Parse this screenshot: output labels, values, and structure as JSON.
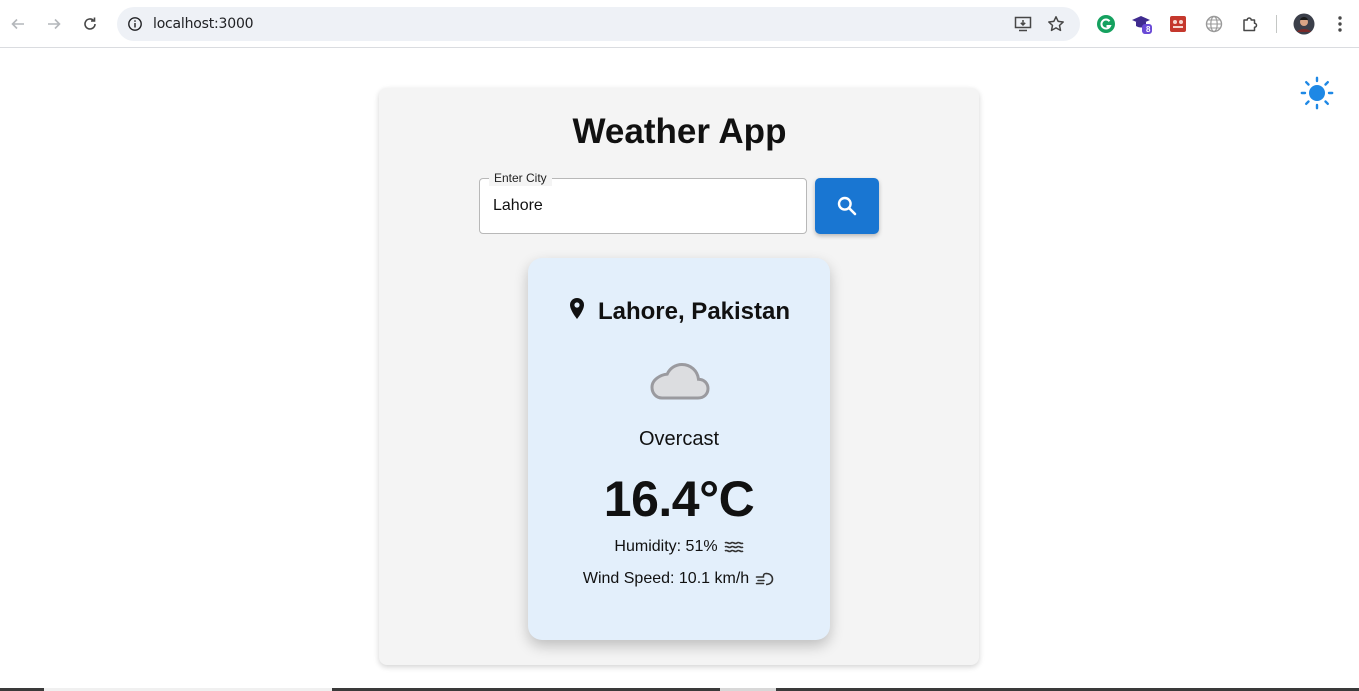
{
  "browser": {
    "url": "localhost:3000",
    "extension_badge": "8"
  },
  "app": {
    "title": "Weather App",
    "search": {
      "label": "Enter City",
      "value": "Lahore"
    },
    "weather": {
      "location": "Lahore, Pakistan",
      "condition": "Overcast",
      "temperature": "16.4°C",
      "humidity": "Humidity: 51%",
      "wind_speed": "Wind Speed: 10.1 km/h"
    }
  },
  "colors": {
    "accent": "#1976d2",
    "card_bg": "#e3effb",
    "panel_bg": "#f4f4f4"
  }
}
